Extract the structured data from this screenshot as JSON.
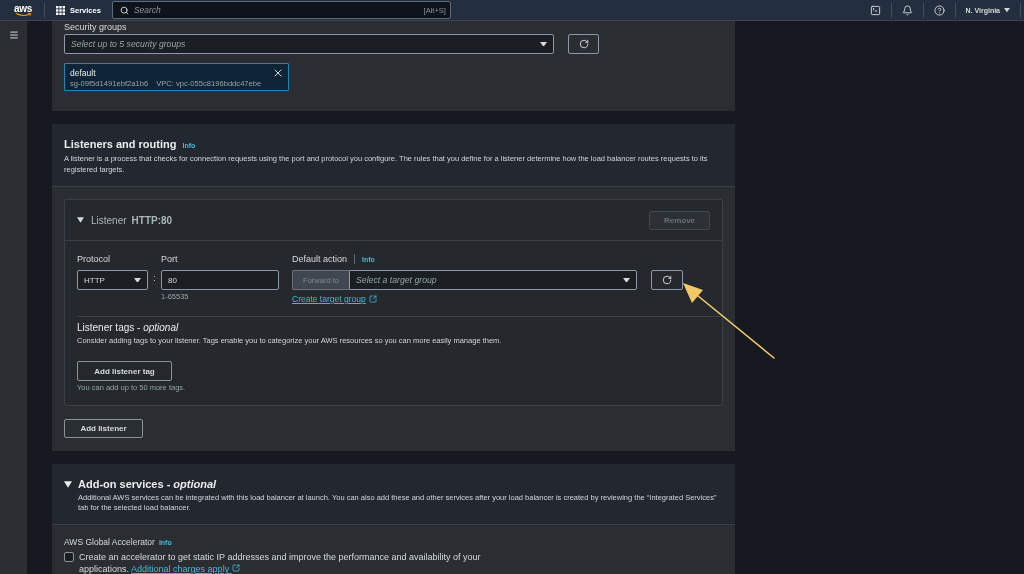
{
  "top_nav": {
    "logo": "aws",
    "services": "Services",
    "search": {
      "placeholder": "Search",
      "shortcut": "[Alt+S]"
    },
    "region": "N. Virginia"
  },
  "security_groups": {
    "label": "Security groups",
    "placeholder": "Select up to 5 security groups",
    "selected_groups": [
      {
        "name": "default",
        "id": "sg-09f5d1491ebf2a1b6",
        "vpc": "VPC: vpc-055c8196bddc47ebe"
      }
    ]
  },
  "listeners_and_routing": {
    "title": "Listeners and routing",
    "info": "Info",
    "description": "A listener is a process that checks for connection requests using the port and protocol you configure. The rules that you define for a listener determine how the load balancer routes requests to its registered targets.",
    "listeners": [
      {
        "expanded": true,
        "label": "Listener",
        "name": "HTTP:80",
        "remove_button": {
          "label": "Remove",
          "disabled": true
        },
        "protocol": {
          "label": "Protocol",
          "value": "HTTP"
        },
        "separator": ":",
        "port": {
          "label": "Port",
          "value": "80",
          "hint": "1-65535"
        },
        "default_action": {
          "label": "Default action",
          "info": "Info",
          "prefix": {
            "label": "Forward to",
            "disabled": true
          },
          "placeholder": "Select a target group",
          "link": "Create target group"
        },
        "tags": {
          "title": "Listener tags - *optional*",
          "description": "Consider adding tags to your listener. Tags enable you to categorize your AWS resources so you can more easily manage them.",
          "button": "Add listener tag",
          "hint": "You can add up to 50 more tags."
        }
      }
    ],
    "add_listener": "Add listener"
  },
  "add_on_services": {
    "expanded": true,
    "title": "Add-on services - *optional*",
    "description": "Additional AWS services can be integrated with this load balancer at launch. You can also add these and other services after your load balancer is created by reviewing the “Integrated Services” tab for the selected load balancer.",
    "options": [
      {
        "title": "AWS Global Accelerator",
        "info": "Info",
        "checked": false,
        "label": "Create an accelerator to get static IP addresses and improve the performance and availability of your applications.",
        "link": "Additional charges apply"
      }
    ]
  }
}
